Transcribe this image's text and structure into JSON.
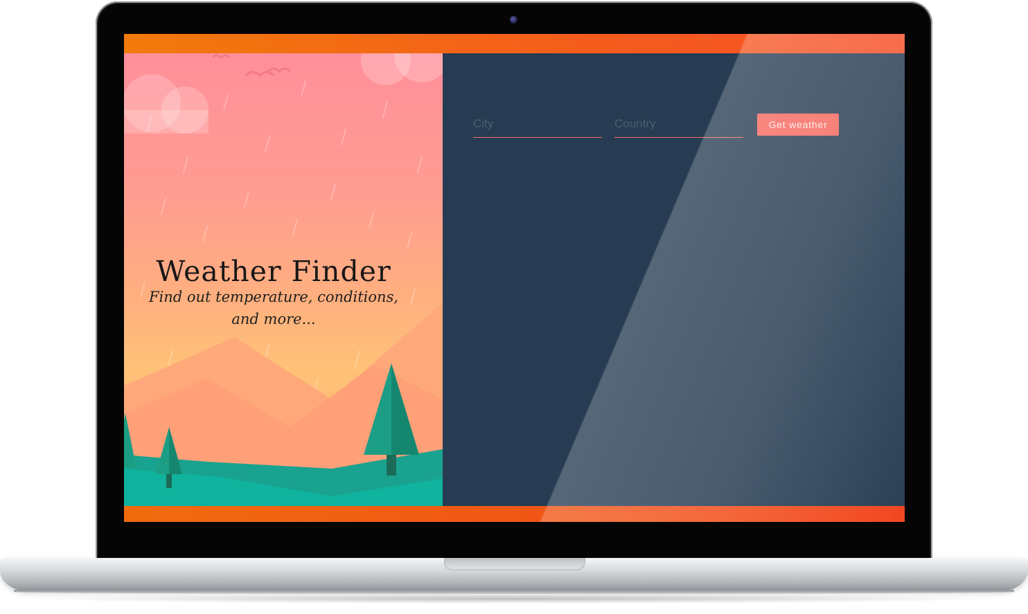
{
  "app": {
    "title": "Weather Finder",
    "subtitle": "Find out temperature, conditions, and more..."
  },
  "form": {
    "city_placeholder": "City",
    "country_placeholder": "Country",
    "submit_label": "Get weather"
  },
  "colors": {
    "accent": "#f7685e",
    "panel_background": "#273c52",
    "bar_orange": "#f45c1c",
    "hero_pink": "#ff8f9a",
    "hero_peach": "#ffb07e",
    "tree_green": "#1c9e85"
  },
  "icons": [
    "cloud-icon",
    "bird-icon",
    "mountain-icon",
    "tree-icon",
    "camera-icon"
  ]
}
